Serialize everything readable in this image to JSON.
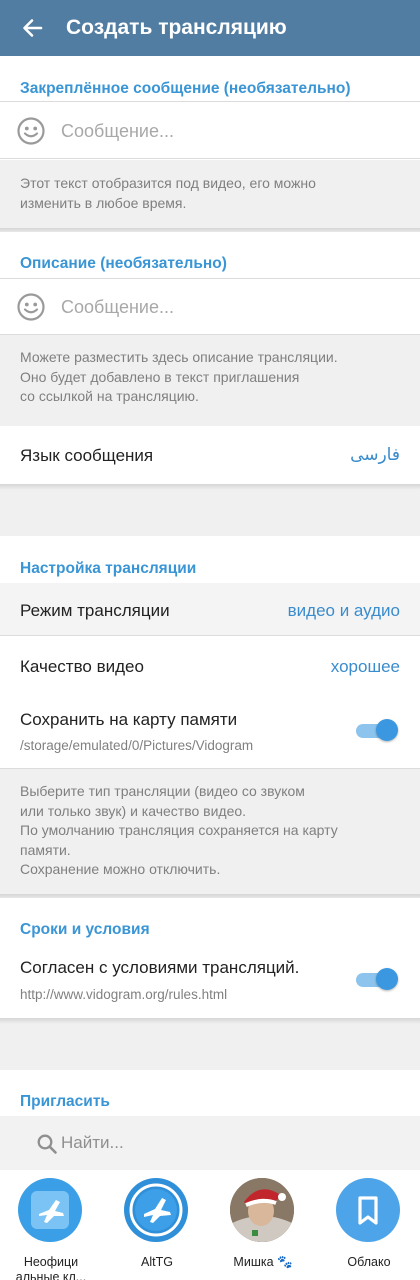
{
  "appbar": {
    "title": "Создать трансляцию"
  },
  "pinned": {
    "header": "Закреплённое сообщение (необязательно)",
    "placeholder": "Сообщение...",
    "hint": "Этот текст отобразится под видео, его можно\nизменить в любое время."
  },
  "description": {
    "header": "Описание (необязательно)",
    "placeholder": "Сообщение...",
    "hint": "Можете разместить здесь описание трансляции.\nОно будет добавлено в текст приглашения\nсо ссылкой на трансляцию."
  },
  "language": {
    "label": "Язык сообщения",
    "value": "فارسی"
  },
  "broadcast_settings": {
    "header": "Настройка трансляции",
    "mode_label": "Режим трансляции",
    "mode_value": "видео и аудио",
    "quality_label": "Качество видео",
    "quality_value": "хорошее",
    "save_label": "Сохранить на карту памяти",
    "save_path": "/storage/emulated/0/Pictures/Vidogram",
    "save_enabled": true,
    "hint": "Выберите тип трансляции (видео со звуком\nили только звук) и качество видео.\nПо умолчанию трансляция сохраняется на карту\nпамяти.\nСохранение можно отключить."
  },
  "terms": {
    "header": "Сроки и условия",
    "agree_label": "Согласен с условиями трансляций.",
    "url": "http://www.vidogram.org/rules.html",
    "agree_enabled": true
  },
  "invite": {
    "header": "Пригласить",
    "search_placeholder": "Найти..."
  },
  "contacts": [
    {
      "name": "Неофици\nальные кл...",
      "icon": "plane-logo-icon"
    },
    {
      "name": "AltTG",
      "icon": "plane-logo-icon"
    },
    {
      "name": "Мишка 🐾",
      "icon": "user-photo"
    },
    {
      "name": "Облако",
      "icon": "bookmark-icon"
    }
  ],
  "colors": {
    "appbar": "#527da3",
    "accent": "#3a95d5",
    "toggle": "#3b98e0"
  }
}
